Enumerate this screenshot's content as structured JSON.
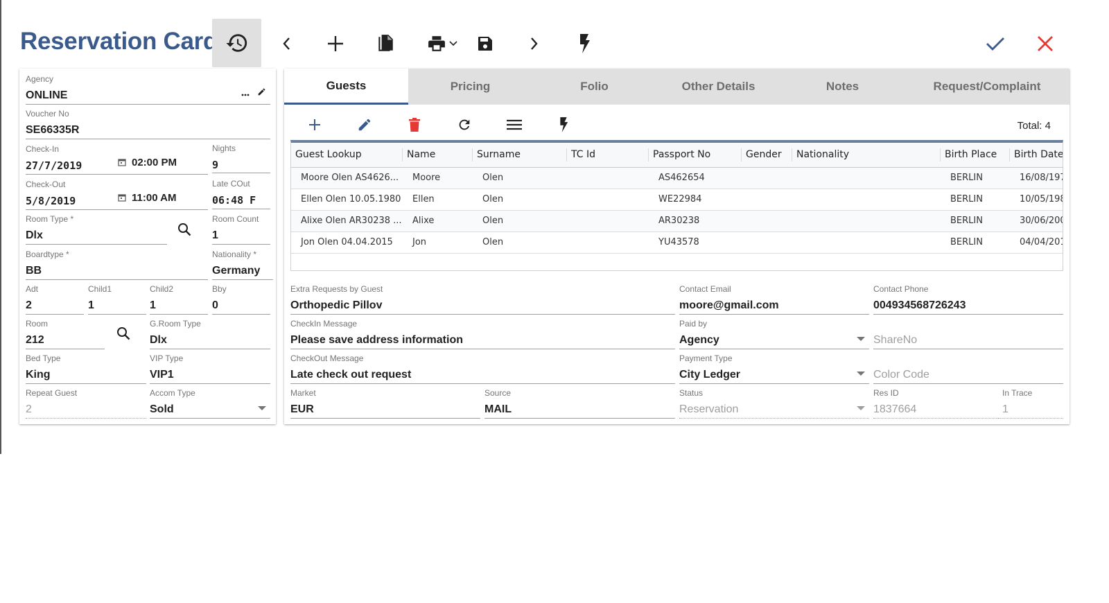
{
  "header": {
    "title": "Reservation Card",
    "toolbar": [
      {
        "name": "history",
        "icon": "history-icon"
      },
      {
        "name": "previous",
        "icon": "chevron-left-icon"
      },
      {
        "name": "add",
        "icon": "plus-icon"
      },
      {
        "name": "copy",
        "icon": "copy-icon"
      },
      {
        "name": "print",
        "icon": "print-icon"
      },
      {
        "name": "save",
        "icon": "save-icon"
      },
      {
        "name": "next",
        "icon": "chevron-right-icon"
      },
      {
        "name": "quick-action",
        "icon": "lightning-icon"
      }
    ],
    "confirm_icon": "check-icon",
    "close_icon": "close-icon",
    "colors": {
      "title": "#3a5a8c",
      "confirm": "#3a5a8c",
      "close": "#e53935",
      "delete": "#e53935"
    }
  },
  "left": {
    "agency": {
      "label": "Agency",
      "value": "ONLINE"
    },
    "voucher": {
      "label": "Voucher No",
      "value": "SE66335R"
    },
    "checkin": {
      "label": "Check-In",
      "date": "27/7/2019",
      "time": "02:00 PM"
    },
    "nights": {
      "label": "Nights",
      "value": "9"
    },
    "checkout": {
      "label": "Check-Out",
      "date": "5/8/2019",
      "time": "11:00 AM"
    },
    "late_cout": {
      "label": "Late COut",
      "value": "06:48 F"
    },
    "room_type": {
      "label": "Room Type *",
      "value": "Dlx"
    },
    "room_count": {
      "label": "Room Count",
      "value": "1"
    },
    "boardtype": {
      "label": "Boardtype *",
      "value": "BB"
    },
    "nationality": {
      "label": "Nationality *",
      "value": "Germany"
    },
    "adt": {
      "label": "Adt",
      "value": "2"
    },
    "child1": {
      "label": "Child1",
      "value": "1"
    },
    "child2": {
      "label": "Child2",
      "value": "1"
    },
    "bby": {
      "label": "Bby",
      "value": "0"
    },
    "room": {
      "label": "Room",
      "value": "212"
    },
    "groom_type": {
      "label": "G.Room Type",
      "value": "Dlx"
    },
    "bed_type": {
      "label": "Bed Type",
      "value": "King"
    },
    "vip_type": {
      "label": "VIP Type",
      "value": "VIP1"
    },
    "repeat_guest": {
      "label": "Repeat Guest",
      "value": "2"
    },
    "accom_type": {
      "label": "Accom Type",
      "value": "Sold"
    }
  },
  "tabs": [
    {
      "label": "Guests",
      "active": true
    },
    {
      "label": "Pricing"
    },
    {
      "label": "Folio"
    },
    {
      "label": "Other Details"
    },
    {
      "label": "Notes"
    },
    {
      "label": "Request/Complaint"
    }
  ],
  "guests": {
    "total_label": "Total: 4",
    "columns": [
      "Guest Lookup",
      "Name",
      "Surname",
      "TC Id",
      "Passport No",
      "Gender",
      "Nationality",
      "Birth Place",
      "Birth Date"
    ],
    "rows": [
      [
        "Moore Olen AS4626...",
        "Moore",
        "Olen",
        "",
        "AS462654",
        "",
        "",
        "BERLIN",
        "16/08/197"
      ],
      [
        "Ellen Olen 10.05.1980",
        "Ellen",
        "Olen",
        "",
        "WE22984",
        "",
        "",
        "BERLIN",
        "10/05/198"
      ],
      [
        "Alixe Olen AR30238 ...",
        "Alixe",
        "Olen",
        "",
        "AR30238",
        "",
        "",
        "BERLIN",
        "30/06/200"
      ],
      [
        "Jon Olen 04.04.2015",
        "Jon",
        "Olen",
        "",
        "YU43578",
        "",
        "",
        "BERLIN",
        "04/04/201"
      ]
    ]
  },
  "details": {
    "extra_requests": {
      "label": "Extra Requests by Guest",
      "value": "Orthopedic Pillov"
    },
    "contact_email": {
      "label": "Contact Email",
      "value": "moore@gmail.com"
    },
    "contact_phone": {
      "label": "Contact Phone",
      "value": "004934568726243"
    },
    "checkin_message": {
      "label": "CheckIn Message",
      "value": "Please save address information"
    },
    "paid_by": {
      "label": "Paid by",
      "value": "Agency"
    },
    "share_no": {
      "placeholder": "ShareNo"
    },
    "checkout_message": {
      "label": "CheckOut Message",
      "value": "Late check out request"
    },
    "payment_type": {
      "label": "Payment Type",
      "value": "City Ledger"
    },
    "color_code": {
      "placeholder": "Color Code"
    },
    "market": {
      "label": "Market",
      "value": "EUR"
    },
    "source": {
      "label": "Source",
      "value": "MAIL"
    },
    "status": {
      "label": "Status",
      "value": "Reservation"
    },
    "res_id": {
      "label": "Res ID",
      "value": "1837664"
    },
    "in_trace": {
      "label": "In Trace",
      "value": "1"
    }
  }
}
